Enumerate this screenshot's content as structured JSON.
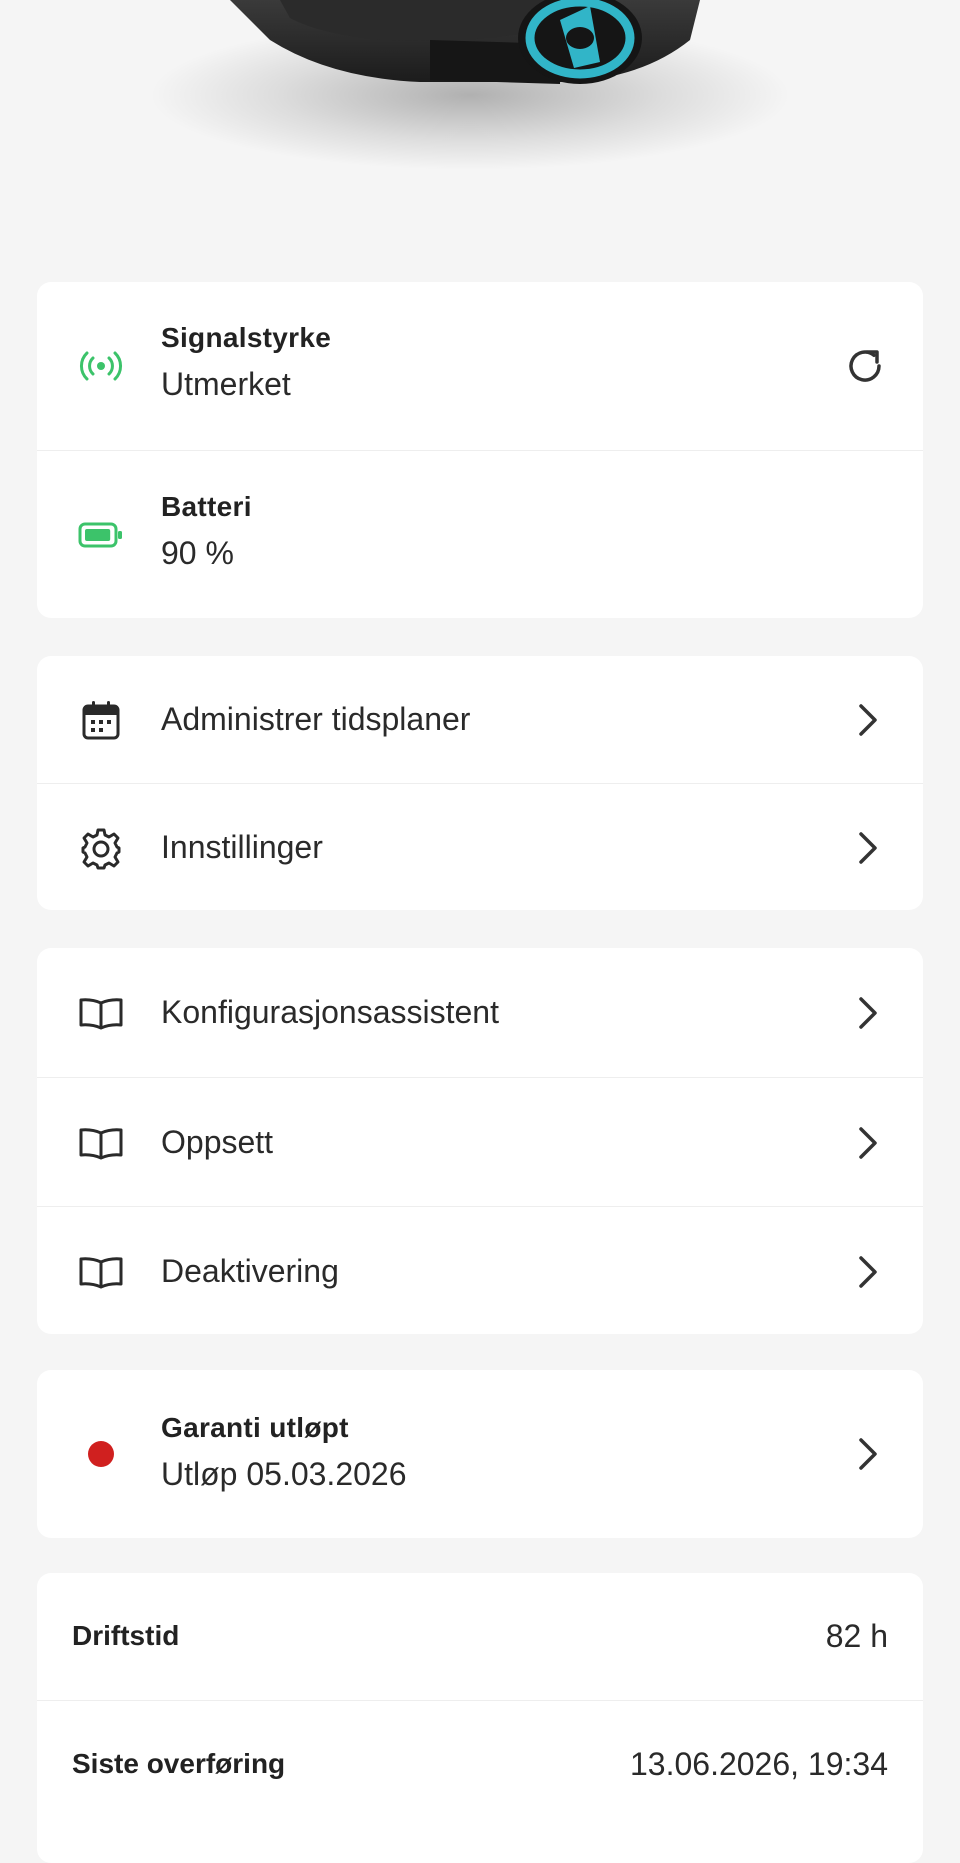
{
  "status_card": {
    "signal": {
      "title": "Signalstyrke",
      "value": "Utmerket",
      "icon": "signal-icon",
      "action_icon": "refresh-icon",
      "color": "#3cc36a"
    },
    "battery": {
      "title": "Batteri",
      "value": "90 %",
      "icon": "battery-icon",
      "level": 0.9,
      "color": "#3cc36a"
    }
  },
  "menu_card": {
    "items": [
      {
        "label": "Administrer tidsplaner",
        "icon": "calendar-icon"
      },
      {
        "label": "Innstillinger",
        "icon": "gear-icon"
      }
    ]
  },
  "guides_card": {
    "items": [
      {
        "label": "Konfigurasjonsassistent",
        "icon": "book-icon"
      },
      {
        "label": "Oppsett",
        "icon": "book-icon"
      },
      {
        "label": "Deaktivering",
        "icon": "book-icon"
      }
    ]
  },
  "warranty_card": {
    "title": "Garanti utløpt",
    "value": "Utløp 05.03.2026",
    "status_color": "#d0201f"
  },
  "info_card": {
    "rows": [
      {
        "key": "Driftstid",
        "value": "82 h"
      },
      {
        "key": "Siste overføring",
        "value": "13.06.2026, 19:34"
      }
    ]
  }
}
